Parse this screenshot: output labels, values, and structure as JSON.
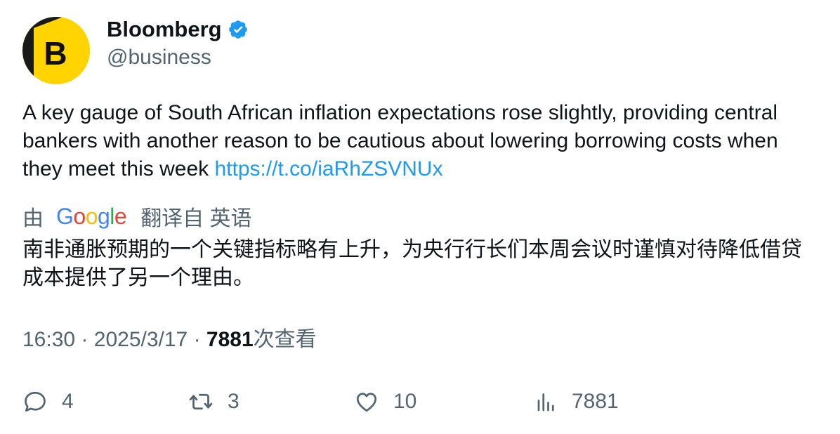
{
  "author": {
    "display_name": "Bloomberg",
    "handle": "@business",
    "avatar_letter": "B",
    "avatar_color": "#ffd400",
    "verified": true,
    "verified_color": "#1d9bf0"
  },
  "tweet": {
    "text": "A key gauge of South African inflation expectations rose slightly, providing central bankers with another reason to be cautious about lowering borrowing costs when they meet this week ",
    "link": "https://t.co/iaRhZSVNUx",
    "link_color": "#1d9bf0"
  },
  "translation": {
    "prefix": "由",
    "provider_letters": [
      "G",
      "o",
      "o",
      "g",
      "l",
      "e"
    ],
    "suffix": "翻译自 英语",
    "text": "南非通胀预期的一个关键指标略有上升，为央行行长们本周会议时谨慎对待降低借贷成本提供了另一个理由。"
  },
  "meta": {
    "time": "16:30",
    "separator": "·",
    "date": "2025/3/17",
    "views": "7881",
    "views_label": "次查看"
  },
  "actions": {
    "replies": "4",
    "retweets": "3",
    "likes": "10",
    "views": "7881"
  },
  "icons": [
    "verified-badge-icon",
    "reply-icon",
    "retweet-icon",
    "heart-icon",
    "analytics-icon"
  ]
}
